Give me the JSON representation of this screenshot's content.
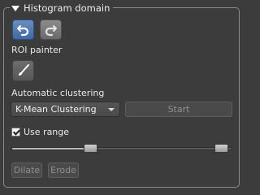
{
  "group": {
    "title": "Histogram domain",
    "collapse_icon": "triangle-down-icon"
  },
  "history": {
    "undo_icon": "undo-icon",
    "redo_icon": "redo-icon",
    "undo_color": "#4a74ad",
    "redo_color": "#7a7a7a"
  },
  "roi": {
    "label": "ROI painter",
    "brush_icon": "brush-icon"
  },
  "clustering": {
    "label": "Automatic clustering",
    "method_selected": "K-Mean Clustering",
    "start_label": "Start"
  },
  "range": {
    "use_range_label": "Use range",
    "use_range_checked": true,
    "low_fraction": 0.35,
    "high_fraction": 0.98
  },
  "morphology": {
    "dilate_label": "Dilate",
    "erode_label": "Erode"
  }
}
